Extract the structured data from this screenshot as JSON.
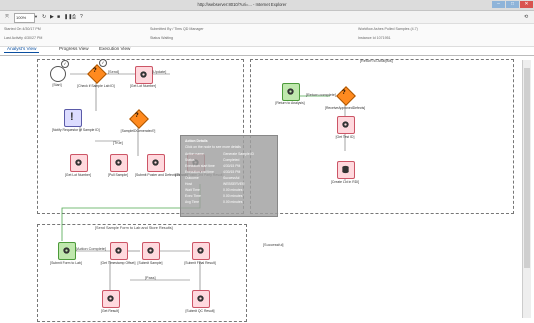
{
  "window": {
    "title": "http://webserver:8010/?uri=...  - Internet Explorer",
    "controls": [
      "–",
      "□",
      "✕"
    ]
  },
  "toolbar": {
    "zoom": "100%",
    "buttons": [
      "refresh",
      "play",
      "stop",
      "pause",
      "print",
      "help"
    ]
  },
  "info": {
    "started": "Started On  4/30/17 PM",
    "last_activity": "Last Activity  4/30/27 PM",
    "submitted_by": "Submitted By  / Tims QD Manager",
    "status": "Status  Waiting",
    "workflow": "Workflow  Ashes Pulled Samples (4.7)",
    "instance": "Instance Id  1071951"
  },
  "tabs": [
    "Analyst's View",
    "Progress View",
    "Execution View"
  ],
  "regions": {
    "top_left": "",
    "top_right": "[Return to Analysis]",
    "bottom": "[Send Sample Form to Lab and Store Results]",
    "side_label": "[Successful]"
  },
  "nodes": {
    "start": "[Start]",
    "check_complete": "[Check if Sample Lab ID]",
    "get_lot": "[Get Lot Number]",
    "send": "[Send]",
    "update": "[Update]",
    "notify": "[Notify Requestor of Sample ID]",
    "sample_generated": "[SampleIDGenerated?]",
    "get_lot2": "[Get Lot Number]",
    "pull_sample": "[Pull Sample]",
    "submit_pos": "[Submit Poster and Defects Result]",
    "submit_third": "[Submit Poster 3rd Party Result]",
    "return_analysis": "[Return to Analysis]",
    "receive_approved": "[ReceiveApprovedDefects]",
    "get_test": "[Get Test ID]",
    "create_lot": "[Create Lot in RDI]",
    "submit_lab": "[Submit Form to Lab]",
    "get_timestamp": "[Get Timestamp Offset]",
    "submit_sample": "[Submit Sample]",
    "submit_result": "[Submit Final Result]",
    "get_result": "[Get Result]",
    "submit_qc": "[Submit QC Result]"
  },
  "edges": {
    "send": "[Send]",
    "update": "[Update]",
    "success": "[Successful]",
    "true": "[True]",
    "false": "[False]",
    "return_complete": "[Return complete]",
    "action_complete": "[Action Complete]",
    "pass": "[Pass]"
  },
  "tooltip": {
    "title": "Action Details",
    "subtitle": "Click on the node to see more details",
    "rows": [
      {
        "k": "Action name",
        "v": "Generate Sample ID"
      },
      {
        "k": "Status",
        "v": "Completed"
      },
      {
        "k": "Execution start time",
        "v": "4/30/15 PM"
      },
      {
        "k": "Execution end time",
        "v": "4/30/15 PM"
      },
      {
        "k": "Outcome",
        "v": "Successful"
      },
      {
        "k": "Host",
        "v": "WEBSERVER"
      },
      {
        "k": "Wait Time",
        "v": "0.00 minutes"
      },
      {
        "k": "Exec Time",
        "v": "0.00 minutes"
      },
      {
        "k": "Avg Time",
        "v": "0.00 minutes"
      }
    ]
  },
  "colors": {
    "node_fill": "#ffd9de",
    "node_border": "#cc5566",
    "decision": "#ff8a1f",
    "start": "#7cc35a",
    "success_line": "#4ca64c",
    "check": "#333333"
  }
}
